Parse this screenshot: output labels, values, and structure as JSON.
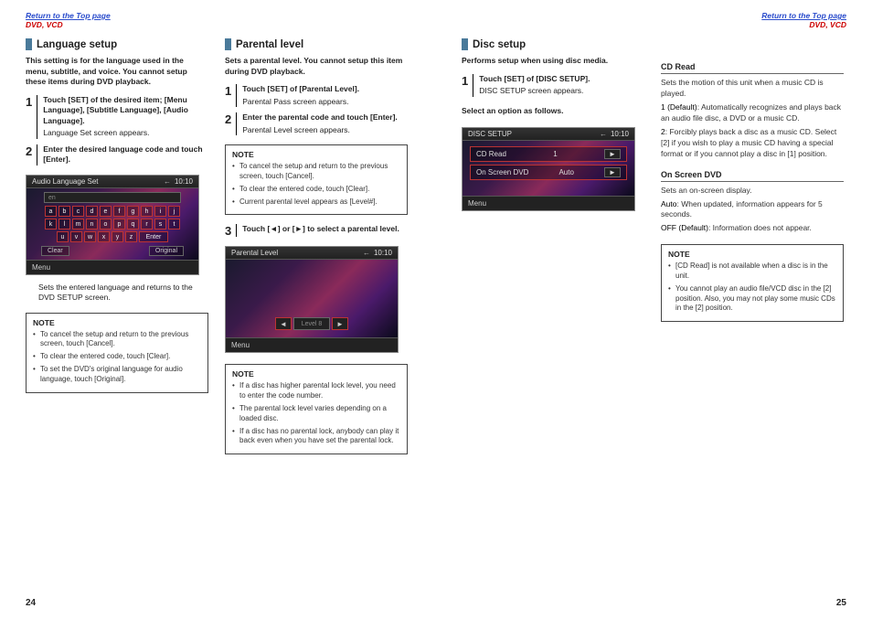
{
  "header": {
    "return_link": "Return to the Top page",
    "section": "DVD, VCD"
  },
  "left_page": {
    "page_num": "24",
    "col1": {
      "title": "Language setup",
      "lead": "This setting is for the language used in the menu, subtitle, and voice. You cannot setup these items during DVD playback.",
      "steps": [
        {
          "n": "1",
          "cmd": "Touch [SET] of the desired item; [Menu Language], [Subtitle Language], [Audio Language].",
          "result": "Language Set screen appears."
        },
        {
          "n": "2",
          "cmd": "Enter the desired language code and touch [Enter].",
          "result": ""
        }
      ],
      "ss1": {
        "title": "Audio Language Set",
        "time": "10:10",
        "input": "en",
        "rows": [
          [
            "a",
            "b",
            "c",
            "d",
            "e",
            "f",
            "g",
            "h",
            "i",
            "j"
          ],
          [
            "k",
            "l",
            "m",
            "n",
            "o",
            "p",
            "q",
            "r",
            "s",
            "t"
          ],
          [
            "u",
            "v",
            "w",
            "x",
            "y",
            "z",
            "",
            "",
            "",
            ""
          ]
        ],
        "enter": "Enter",
        "clear": "Clear",
        "original": "Original",
        "menu": "Menu"
      },
      "caption1": "Sets the entered language and returns to the DVD SETUP screen.",
      "note_title": "NOTE",
      "notes": [
        "To cancel the setup and return to the previous screen, touch [Cancel].",
        "To clear the entered code, touch [Clear].",
        "To set the DVD's original language for audio language, touch [Original]."
      ]
    },
    "col2": {
      "title": "Parental level",
      "lead": "Sets a parental level. You cannot setup this item during DVD playback.",
      "steps12": [
        {
          "n": "1",
          "cmd": "Touch [SET] of [Parental Level].",
          "result": "Parental Pass screen appears."
        },
        {
          "n": "2",
          "cmd": "Enter the parental code and touch [Enter].",
          "result": "Parental Level screen appears."
        }
      ],
      "note1_title": "NOTE",
      "note1": [
        "To cancel the setup and return to the previous screen, touch [Cancel].",
        "To clear the entered code, touch [Clear].",
        "Current parental level appears as [Level#]."
      ],
      "step3": {
        "n": "3",
        "cmd": "Touch [◄] or [►] to select a parental level."
      },
      "ss2": {
        "title": "Parental Level",
        "time": "10:10",
        "level_label": "Level 8",
        "menu": "Menu"
      },
      "note2_title": "NOTE",
      "note2": [
        "If a disc has higher parental lock level, you need to enter the code number.",
        "The parental lock level varies depending on a loaded disc.",
        "If a disc has no parental lock, anybody can play it back even when you have set the parental lock."
      ]
    }
  },
  "right_page": {
    "page_num": "25",
    "col1": {
      "title": "Disc setup",
      "lead": "Performs setup when using disc media.",
      "step1": {
        "n": "1",
        "cmd": "Touch [SET] of [DISC SETUP].",
        "result": "DISC SETUP screen appears."
      },
      "select_text": "Select an option as follows.",
      "ss3": {
        "title": "DISC SETUP",
        "time": "10:10",
        "row1_label": "CD Read",
        "row1_value": "1",
        "row2_label": "On Screen DVD",
        "row2_value": "Auto",
        "menu": "Menu"
      }
    },
    "col2": {
      "cd_read": {
        "title": "CD Read",
        "intro": "Sets the motion of this unit when a music CD is played.",
        "opt1_label": "1 (Default)",
        "opt1_text": ": Automatically recognizes and plays back an audio file disc, a DVD or a music CD.",
        "opt2_label": "2",
        "opt2_text": ": Forcibly plays back a disc as a music CD. Select [2] if you wish to play a music CD having a special format or if you cannot play a disc in [1] position."
      },
      "on_screen": {
        "title": "On Screen DVD",
        "intro": "Sets an on-screen display.",
        "opt1_label": "Auto",
        "opt1_text": ": When updated, information appears for 5 seconds.",
        "opt2_label": "OFF (Default)",
        "opt2_text": ": Information does not appear."
      },
      "note_title": "NOTE",
      "notes": [
        "[CD Read] is not available when a disc is in the unit.",
        "You cannot play an audio file/VCD disc in the [2] position. Also, you may not play some music CDs in the [2] position."
      ]
    }
  }
}
